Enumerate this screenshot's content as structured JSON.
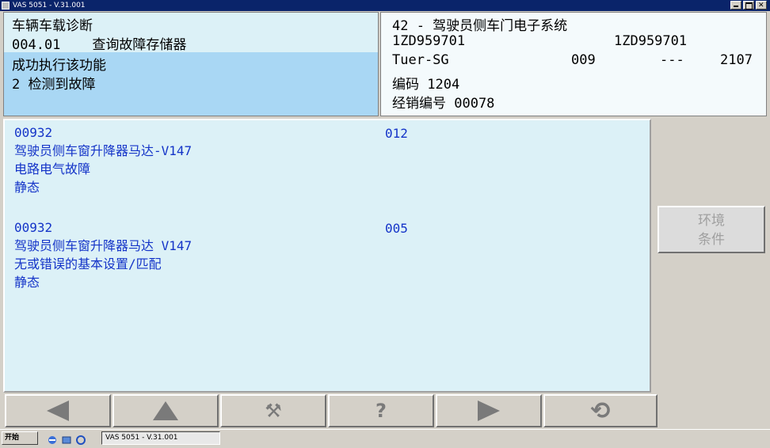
{
  "window": {
    "title": "VAS 5051 - V.31.001"
  },
  "header_left": {
    "line1": "车辆车载诊断",
    "line2_code": "004.01",
    "line2_text": "查询故障存储器",
    "line3": "成功执行该功能",
    "line4": "2 检测到故障"
  },
  "header_right": {
    "system": "42 - 驾驶员侧车门电子系统",
    "part_no_1": "1ZD959701",
    "part_no_2": "1ZD959701",
    "component": "Tuer-SG",
    "version": "009",
    "dashes": "---",
    "sw": "2107",
    "coding": "编码 1204",
    "dealer": "经销编号 00078"
  },
  "faults": [
    {
      "code": "00932",
      "name": "驾驶员侧车窗升降器马达-V147",
      "description": "电路电气故障",
      "status": "静态",
      "fault_code": "012"
    },
    {
      "code": "00932",
      "name": "驾驶员侧车窗升降器马达 V147",
      "description": "无或错误的基本设置/匹配",
      "status": "静态",
      "fault_code": "005"
    }
  ],
  "side": {
    "env_label_1": "环境",
    "env_label_2": "条件"
  },
  "toolbar": {
    "icons": [
      "arrow-left-icon",
      "arrow-up-icon",
      "tools-icon",
      "help-icon",
      "arrow-right-icon",
      "refresh-icon"
    ],
    "tools_glyph": "⚒",
    "help_glyph": "?",
    "refresh_glyph": "⟲"
  },
  "taskbar": {
    "start_label": "开始",
    "task_label": "VAS 5051 - V.31.001"
  },
  "colors": {
    "panel": "#dcf1f7",
    "selection": "#a9d7f4",
    "fault_text": "#1434c8",
    "chrome": "#d4d0c8"
  }
}
